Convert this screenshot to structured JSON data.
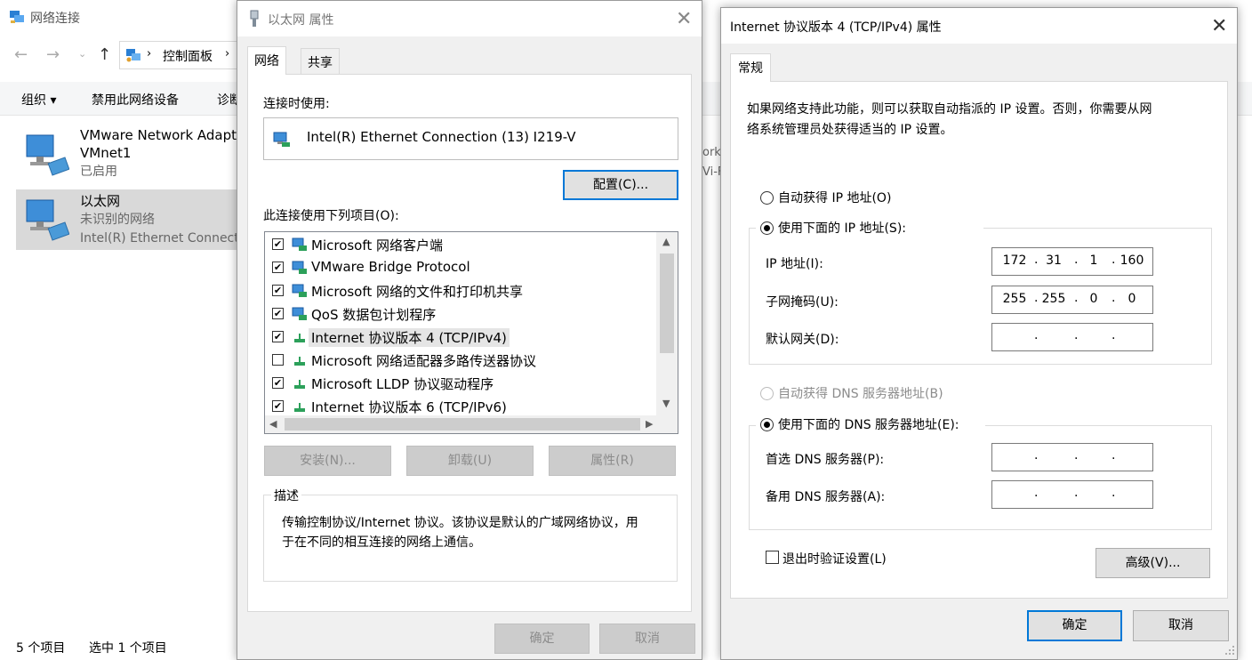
{
  "explorer": {
    "title": "网络连接",
    "breadcrumb": "控制面板",
    "commands": [
      "组织 ▾",
      "禁用此网络设备",
      "诊断"
    ],
    "items": [
      {
        "name": "VMware Network Adapter",
        "name2": "VMnet1",
        "status": "已启用"
      },
      {
        "name": "以太网",
        "status": "未识别的网络",
        "device": "Intel(R) Ethernet Connection"
      }
    ],
    "peek": [
      "ork",
      "Vi-F"
    ],
    "status_count": "5 个项目",
    "status_selected": "选中 1 个项目"
  },
  "eth_props": {
    "title": "以太网 属性",
    "tabs": [
      "网络",
      "共享"
    ],
    "connect_using_label": "连接时使用:",
    "adapter": "Intel(R) Ethernet Connection (13) I219-V",
    "configure_label": "配置(C)...",
    "items_label": "此连接使用下列项目(O):",
    "components": [
      {
        "label": "Microsoft 网络客户端",
        "checked": true,
        "icon": "network-client-icon"
      },
      {
        "label": "VMware Bridge Protocol",
        "checked": true,
        "icon": "network-service-icon"
      },
      {
        "label": "Microsoft 网络的文件和打印机共享",
        "checked": true,
        "icon": "network-service-icon"
      },
      {
        "label": "QoS 数据包计划程序",
        "checked": true,
        "icon": "network-service-icon"
      },
      {
        "label": "Internet 协议版本 4 (TCP/IPv4)",
        "checked": true,
        "icon": "protocol-icon"
      },
      {
        "label": "Microsoft 网络适配器多路传送器协议",
        "checked": false,
        "icon": "protocol-icon"
      },
      {
        "label": "Microsoft LLDP 协议驱动程序",
        "checked": true,
        "icon": "protocol-icon"
      },
      {
        "label": "Internet 协议版本 6 (TCP/IPv6)",
        "checked": true,
        "icon": "protocol-icon"
      }
    ],
    "install_label": "安装(N)...",
    "uninstall_label": "卸载(U)",
    "properties_label": "属性(R)",
    "description_title": "描述",
    "description_text1": "传输控制协议/Internet 协议。该协议是默认的广域网络协议，用",
    "description_text2": "于在不同的相互连接的网络上通信。",
    "ok_label": "确定",
    "cancel_label": "取消"
  },
  "ipv4_props": {
    "title": "Internet 协议版本 4 (TCP/IPv4) 属性",
    "tab": "常规",
    "intro1": "如果网络支持此功能，则可以获取自动指派的 IP 设置。否则，你需要从网",
    "intro2": "络系统管理员处获得适当的 IP 设置。",
    "auto_ip_label": "自动获得 IP 地址(O)",
    "manual_ip_label": "使用下面的 IP 地址(S):",
    "ip_label": "IP 地址(I):",
    "ip_octets": [
      "172",
      "31",
      "1",
      "160"
    ],
    "mask_label": "子网掩码(U):",
    "mask_octets": [
      "255",
      "255",
      "0",
      "0"
    ],
    "gateway_label": "默认网关(D):",
    "auto_dns_label": "自动获得 DNS 服务器地址(B)",
    "manual_dns_label": "使用下面的 DNS 服务器地址(E):",
    "preferred_dns_label": "首选 DNS 服务器(P):",
    "alternate_dns_label": "备用 DNS 服务器(A):",
    "validate_label": "退出时验证设置(L)",
    "advanced_label": "高级(V)...",
    "ok_label": "确定",
    "cancel_label": "取消"
  },
  "colors": {
    "accent": "#0078d7",
    "selection": "#d9d9d9",
    "dialog_bg": "#f0f0f0"
  }
}
